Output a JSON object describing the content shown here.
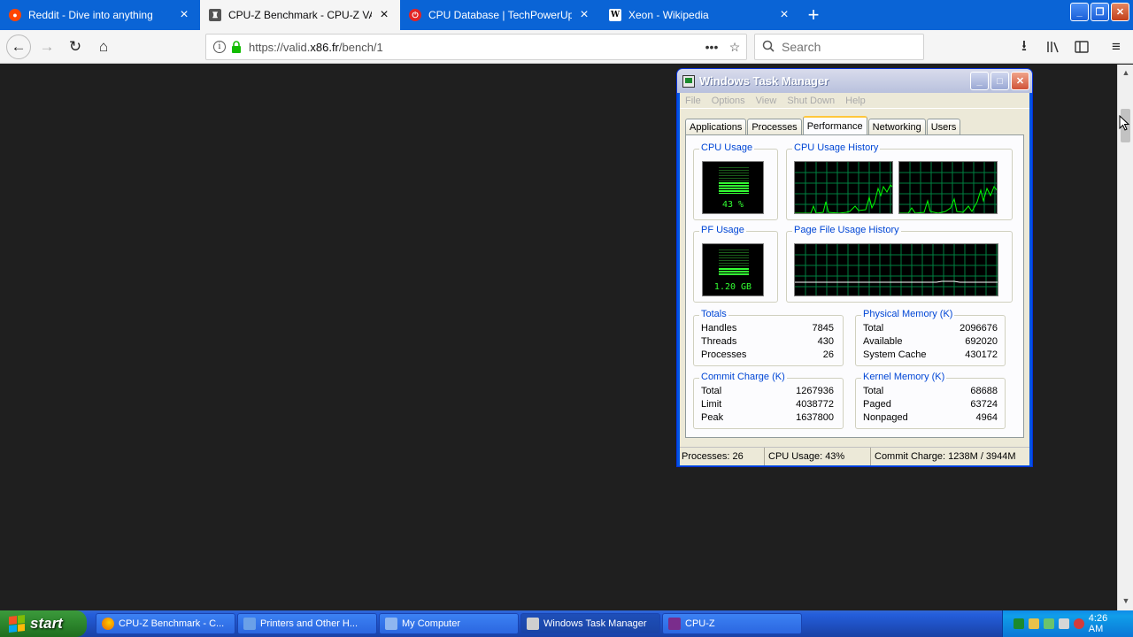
{
  "browser": {
    "tabs": [
      {
        "label": "Reddit - Dive into anything",
        "favicon": "reddit-icon",
        "color": "#ff4500",
        "active": false
      },
      {
        "label": "CPU-Z Benchmark - CPU-Z VALIDA",
        "favicon": "trophy-icon",
        "color": "#555555",
        "active": true
      },
      {
        "label": "CPU Database | TechPowerUp",
        "favicon": "power-icon",
        "color": "#e22424",
        "active": false
      },
      {
        "label": "Xeon - Wikipedia",
        "favicon": "wikipedia-icon",
        "color": "#ffffff",
        "active": false
      }
    ],
    "new_tab_label": "+",
    "url_prefix": "https://valid.",
    "url_host": "x86.fr",
    "url_path": "/bench/1",
    "search_placeholder": "Search"
  },
  "taskmgr": {
    "title": "Windows Task Manager",
    "menu": [
      "File",
      "Options",
      "View",
      "Shut Down",
      "Help"
    ],
    "tabs": [
      "Applications",
      "Processes",
      "Performance",
      "Networking",
      "Users"
    ],
    "active_tab": "Performance",
    "cpu_usage_label": "CPU Usage",
    "cpu_usage_value": "43 %",
    "cpu_usage_percent": 43,
    "cpu_history_label": "CPU Usage History",
    "pf_usage_label": "PF Usage",
    "pf_usage_value": "1.20 GB",
    "pf_usage_percent": 30,
    "pf_history_label": "Page File Usage History",
    "totals": {
      "label": "Totals",
      "rows": [
        {
          "k": "Handles",
          "v": "7845"
        },
        {
          "k": "Threads",
          "v": "430"
        },
        {
          "k": "Processes",
          "v": "26"
        }
      ]
    },
    "physical": {
      "label": "Physical Memory (K)",
      "rows": [
        {
          "k": "Total",
          "v": "2096676"
        },
        {
          "k": "Available",
          "v": "692020"
        },
        {
          "k": "System Cache",
          "v": "430172"
        }
      ]
    },
    "commit": {
      "label": "Commit Charge (K)",
      "rows": [
        {
          "k": "Total",
          "v": "1267936"
        },
        {
          "k": "Limit",
          "v": "4038772"
        },
        {
          "k": "Peak",
          "v": "1637800"
        }
      ]
    },
    "kernel": {
      "label": "Kernel Memory (K)",
      "rows": [
        {
          "k": "Total",
          "v": "68688"
        },
        {
          "k": "Paged",
          "v": "63724"
        },
        {
          "k": "Nonpaged",
          "v": "4964"
        }
      ]
    },
    "status": {
      "processes": "Processes: 26",
      "cpu": "CPU Usage: 43%",
      "commit": "Commit Charge: 1238M / 3944M"
    }
  },
  "taskbar": {
    "start_label": "start",
    "items": [
      {
        "label": "CPU-Z Benchmark - C...",
        "icon": "firefox-icon",
        "color": "#e66000"
      },
      {
        "label": "Printers and Other H...",
        "icon": "printer-icon",
        "color": "#6aa0e8"
      },
      {
        "label": "My Computer",
        "icon": "computer-icon",
        "color": "#8fb6f0"
      },
      {
        "label": "Windows Task Manager",
        "icon": "taskmgr-icon",
        "color": "#cfcfcf"
      },
      {
        "label": "CPU-Z",
        "icon": "cpuz-icon",
        "color": "#7a2d8c"
      }
    ],
    "clock": "4:26 AM"
  }
}
